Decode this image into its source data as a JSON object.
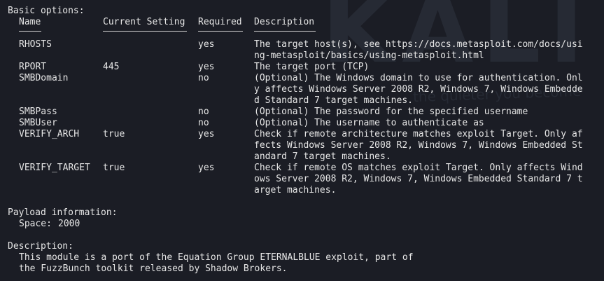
{
  "basic_options": {
    "heading": "Basic options:",
    "columns": {
      "name": "Name",
      "current": "Current Setting",
      "required": "Required",
      "description": "Description"
    },
    "rows": [
      {
        "name": "RHOSTS",
        "current": "",
        "required": "yes",
        "description": [
          "The target host(s), see https://docs.metasploit.com/docs/usi",
          "ng-metasploit/basics/using-metasploit.html"
        ]
      },
      {
        "name": "RPORT",
        "current": "445",
        "required": "yes",
        "description": [
          "The target port (TCP)"
        ]
      },
      {
        "name": "SMBDomain",
        "current": "",
        "required": "no",
        "description": [
          "(Optional) The Windows domain to use for authentication. Onl",
          "y affects Windows Server 2008 R2, Windows 7, Windows Embedde",
          "d Standard 7 target machines."
        ]
      },
      {
        "name": "SMBPass",
        "current": "",
        "required": "no",
        "description": [
          "(Optional) The password for the specified username"
        ]
      },
      {
        "name": "SMBUser",
        "current": "",
        "required": "no",
        "description": [
          "(Optional) The username to authenticate as"
        ]
      },
      {
        "name": "VERIFY_ARCH",
        "current": "true",
        "required": "yes",
        "description": [
          "Check if remote architecture matches exploit Target. Only af",
          "fects Windows Server 2008 R2, Windows 7, Windows Embedded St",
          "andard 7 target machines."
        ]
      },
      {
        "name": "VERIFY_TARGET",
        "current": "true",
        "required": "yes",
        "description": [
          "Check if remote OS matches exploit Target. Only affects Wind",
          "ows Server 2008 R2, Windows 7, Windows Embedded Standard 7 t",
          "arget machines."
        ]
      }
    ]
  },
  "payload_information": {
    "heading": "Payload information:",
    "space_label": "Space:",
    "space_value": "2000"
  },
  "description_section": {
    "heading": "Description:",
    "lines": [
      "This module is a port of the Equation Group ETERNALBLUE exploit, part of",
      "the FuzzBunch toolkit released by Shadow Brokers."
    ]
  },
  "colors": {
    "background": "#1b1d25",
    "text": "#e6e6e6",
    "watermark": "#262a34"
  }
}
